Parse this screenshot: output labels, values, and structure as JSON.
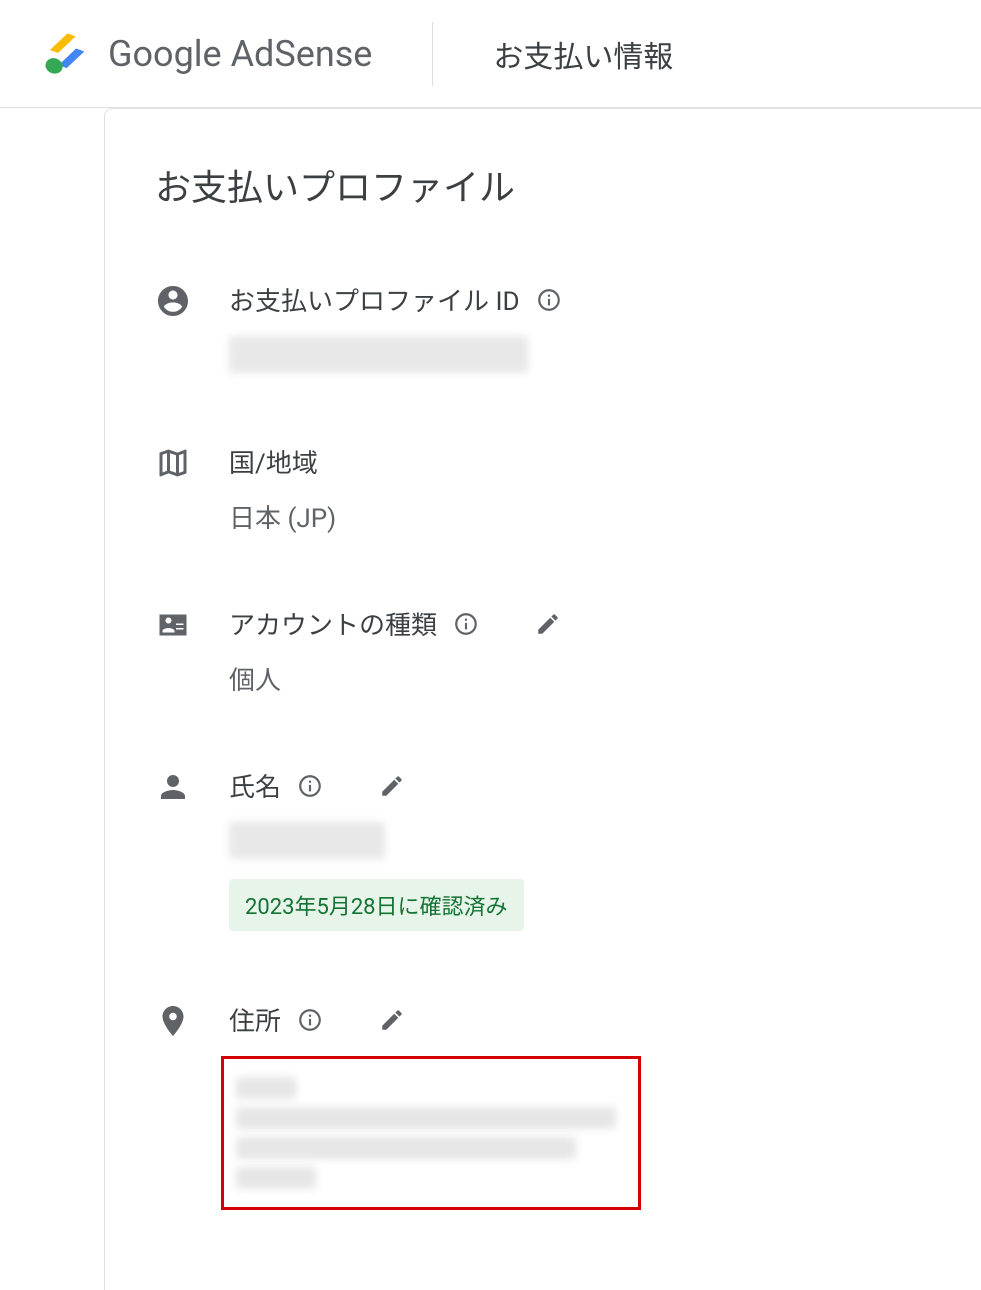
{
  "header": {
    "product_name": "Google AdSense",
    "page_title": "お支払い情報"
  },
  "profile": {
    "section_title": "お支払いプロファイル",
    "fields": {
      "profile_id": {
        "label": "お支払いプロファイル ID",
        "value": "████ ███ ████"
      },
      "country": {
        "label": "国/地域",
        "value": "日本 (JP)"
      },
      "account_type": {
        "label": "アカウントの種類",
        "value": "個人"
      },
      "name": {
        "label": "氏名",
        "value": "██████",
        "verified_badge": "2023年5月28日に確認済み"
      },
      "address": {
        "label": "住所"
      }
    }
  },
  "icons": {
    "person_circle": "person-circle-icon",
    "map": "map-icon",
    "id_card": "id-card-icon",
    "person": "person-icon",
    "place": "place-icon",
    "info": "info-icon",
    "edit": "edit-icon"
  }
}
